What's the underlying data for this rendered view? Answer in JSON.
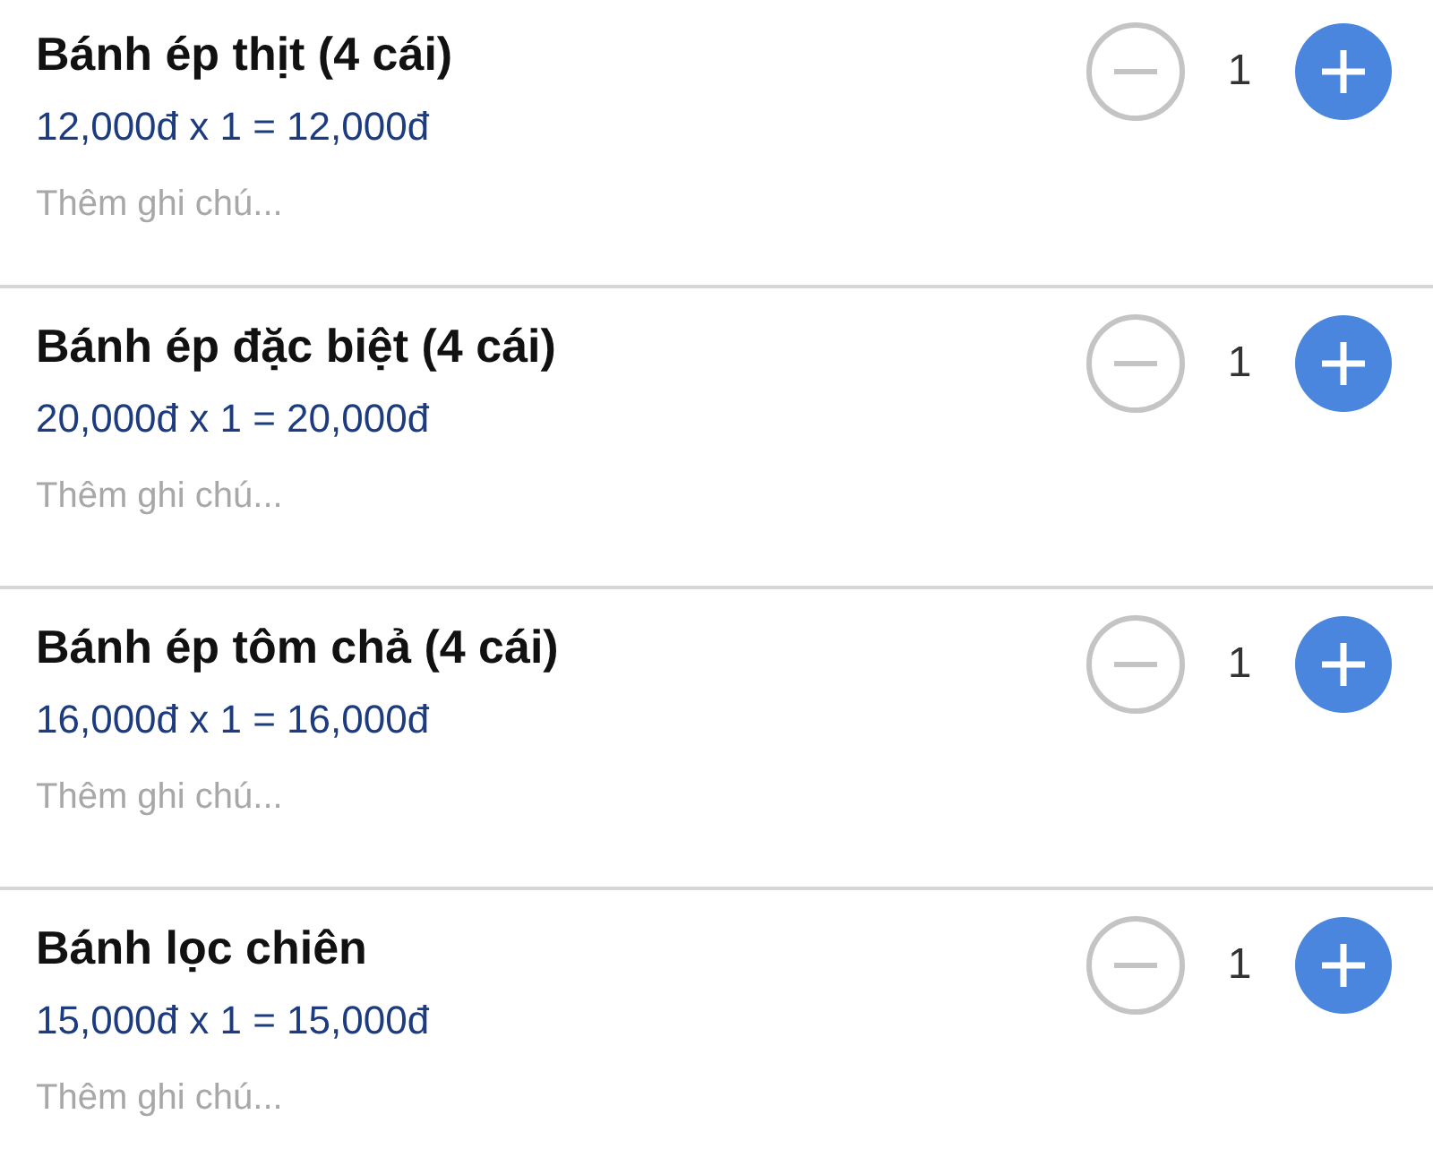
{
  "items": [
    {
      "name": "Bánh ép thịt (4 cái)",
      "price": "12,000đ x 1 = 12,000đ",
      "note": {
        "placeholder": "Thêm ghi chú..."
      },
      "quantity": "1"
    },
    {
      "name": "Bánh ép đặc biệt (4 cái)",
      "price": "20,000đ x 1 = 20,000đ",
      "note": {
        "placeholder": "Thêm ghi chú..."
      },
      "quantity": "1"
    },
    {
      "name": "Bánh ép tôm chả (4 cái)",
      "price": "16,000đ x 1 = 16,000đ",
      "note": {
        "placeholder": "Thêm ghi chú..."
      },
      "quantity": "1"
    },
    {
      "name": "Bánh lọc chiên",
      "price": "15,000đ x 1 = 15,000đ",
      "note": {
        "placeholder": "Thêm ghi chú..."
      },
      "quantity": "1"
    }
  ]
}
